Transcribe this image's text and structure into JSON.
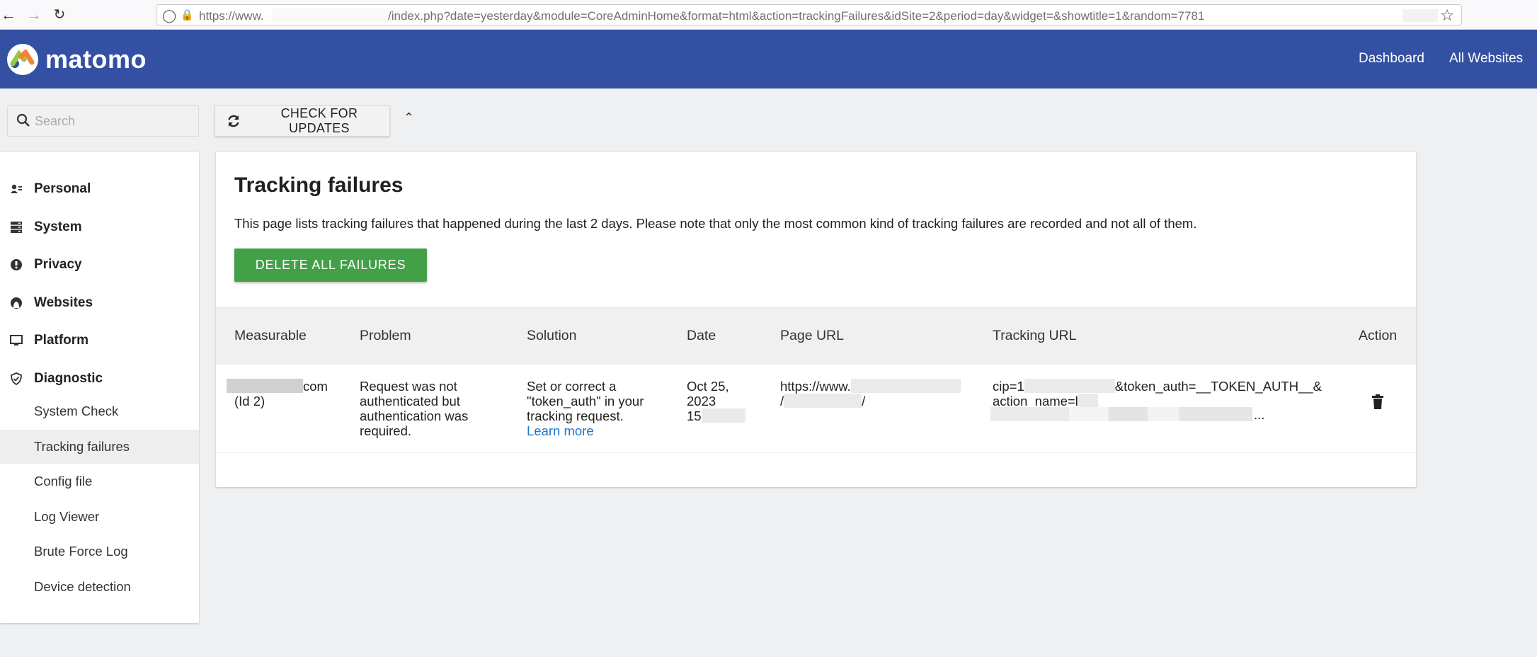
{
  "browser": {
    "url_prefix": "https://www.",
    "url_rest": "/index.php?date=yesterday&module=CoreAdminHome&format=html&action=trackingFailures&idSite=2&period=day&widget=&showtitle=1&random=7781"
  },
  "header": {
    "logo_text": "matomo",
    "nav": [
      "Dashboard",
      "All Websites"
    ]
  },
  "search": {
    "placeholder": "Search"
  },
  "toolbar": {
    "check_updates": "CHECK FOR UPDATES"
  },
  "sidebar": {
    "sections": [
      {
        "label": "Personal",
        "icon": "user-card-icon"
      },
      {
        "label": "System",
        "icon": "server-icon"
      },
      {
        "label": "Privacy",
        "icon": "privacy-icon"
      },
      {
        "label": "Websites",
        "icon": "globe-icon"
      },
      {
        "label": "Platform",
        "icon": "monitor-icon"
      },
      {
        "label": "Diagnostic",
        "icon": "shield-check-icon"
      }
    ],
    "diagnostic_items": [
      "System Check",
      "Tracking failures",
      "Config file",
      "Log Viewer",
      "Brute Force Log",
      "Device detection"
    ],
    "active_item": "Tracking failures"
  },
  "main": {
    "title": "Tracking failures",
    "description": "This page lists tracking failures that happened during the last 2 days. Please note that only the most common kind of tracking failures are recorded and not all of them.",
    "delete_all": "DELETE ALL FAILURES",
    "columns": [
      "Measurable",
      "Problem",
      "Solution",
      "Date",
      "Page URL",
      "Tracking URL",
      "Action"
    ],
    "row": {
      "measurable_suffix": "com",
      "measurable_id": "(Id 2)",
      "problem": "Request was not authenticated but authentication was required.",
      "solution": "Set or correct a \"token_auth\" in your tracking request.",
      "learn_more": "Learn more",
      "date_line1": "Oct 25,",
      "date_line2": "2023",
      "date_line3": "15",
      "page_url_line1": "https://www.",
      "page_url_line2a": "/",
      "page_url_line2b": "/",
      "tracking_url_line1a": "cip=1",
      "tracking_url_line1b": "&token_auth=__TOKEN_AUTH__&",
      "tracking_url_line2": "action_name=l",
      "tracking_url_ellipsis": "..."
    }
  },
  "colors": {
    "header_bg": "#3450a3",
    "delete_button": "#43a047",
    "link": "#1976d2"
  }
}
